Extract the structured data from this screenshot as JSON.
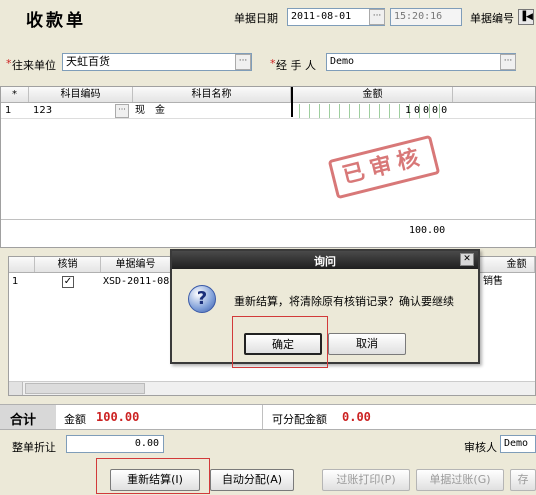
{
  "header": {
    "title": "收款单",
    "date_label": "单据日期",
    "date_value": "2011-08-01",
    "time_value": "15:20:16",
    "docno_label": "单据编号"
  },
  "form": {
    "company_label": "往来单位",
    "company_value": "天虹百货",
    "handler_label": "经 手 人",
    "handler_value": "Demo",
    "required_mark": "*"
  },
  "top_table": {
    "columns": [
      "*",
      "科目编码",
      "科目名称",
      "金额"
    ],
    "rows": [
      {
        "index": "1",
        "code": "123",
        "name": "现　金",
        "amount": "10000"
      }
    ],
    "total": "100.00",
    "stamp": "已审核"
  },
  "bottom_table": {
    "columns": [
      "核销",
      "单据编号",
      "金额"
    ],
    "rows": [
      {
        "index": "1",
        "docno": "XSD-2011-08",
        "tail": "销售"
      }
    ]
  },
  "summary": {
    "total_label": "合计",
    "amount_label": "金额",
    "amount_value": "100.00",
    "alloc_label": "可分配金额",
    "alloc_value": "0.00",
    "discount_label": "整单折让",
    "discount_value": "0.00",
    "reviewer_label": "审核人",
    "reviewer_value": "Demo"
  },
  "buttons": {
    "recalc": "重新结算(I)",
    "auto_alloc": "自动分配(A)",
    "post_print": "过账打印(P)",
    "doc_post": "单据过账(G)",
    "save_partial": "存"
  },
  "dialog": {
    "title": "询问",
    "message": "重新结算，将清除原有核销记录？确认要继续",
    "ok": "确定",
    "cancel": "取消",
    "icon": "question-icon"
  },
  "colors": {
    "accent_red": "#cc2222",
    "dialog_title": "#1f1f1f",
    "stamp": "#c84040"
  }
}
